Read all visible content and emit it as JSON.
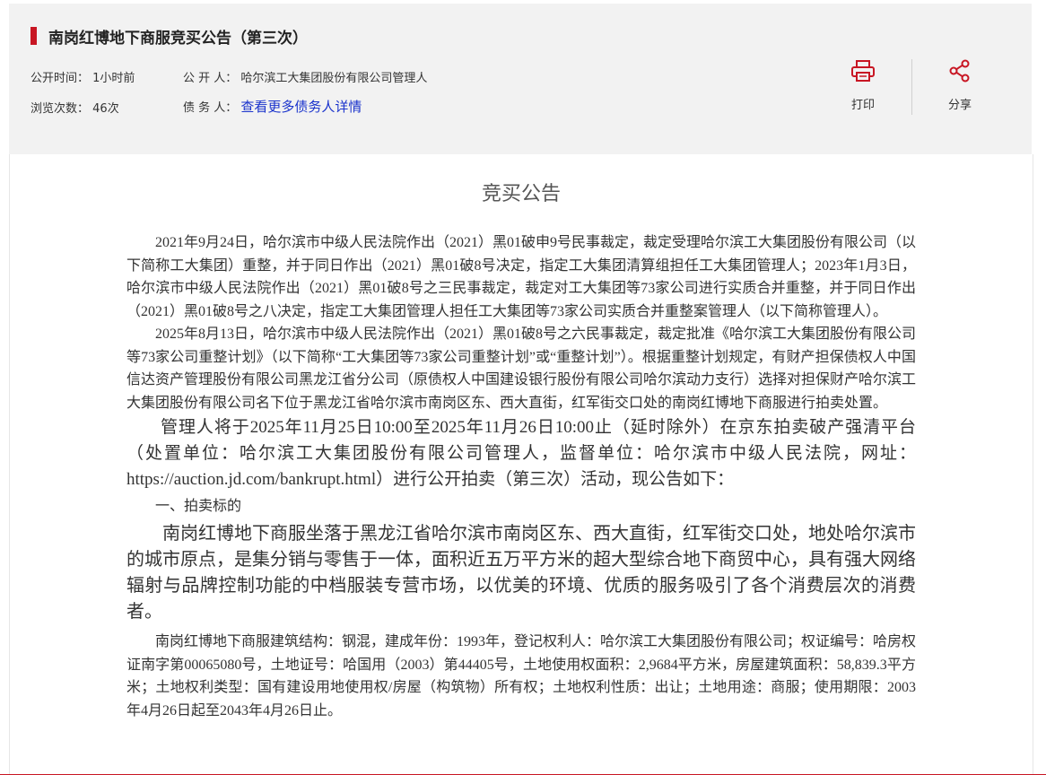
{
  "header": {
    "title": "南岗红博地下商服竞买公告（第三次）",
    "publish_time_label": "公开时间：",
    "publish_time_value": "1小时前",
    "publisher_label": "公 开 人：",
    "publisher_value": "哈尔滨工大集团股份有限公司管理人",
    "views_label": "浏览次数：",
    "views_value": "46次",
    "debtor_label": "债 务 人：",
    "debtor_link": "查看更多债务人详情",
    "print_label": "打印",
    "share_label": "分享",
    "accent_color": "#c81623"
  },
  "article": {
    "heading": "竞买公告",
    "paragraphs": [
      "2021年9月24日，哈尔滨市中级人民法院作出（2021）黑01破申9号民事裁定，裁定受理哈尔滨工大集团股份有限公司（以下简称工大集团）重整，并于同日作出（2021）黑01破8号决定，指定工大集团清算组担任工大集团管理人；2023年1月3日，哈尔滨市中级人民法院作出（2021）黑01破8号之三民事裁定，裁定对工大集团等73家公司进行实质合并重整，并于同日作出（2021）黑01破8号之八决定，指定工大集团管理人担任工大集团等73家公司实质合并重整案管理人（以下简称管理人）。",
      "2025年8月13日，哈尔滨市中级人民法院作出（2021）黑01破8号之六民事裁定，裁定批准《哈尔滨工大集团股份有限公司等73家公司重整计划》（以下简称“工大集团等73家公司重整计划”或“重整计划”）。根据重整计划规定，有财产担保债权人中国信达资产管理股份有限公司黑龙江省分公司（原债权人中国建设银行股份有限公司哈尔滨动力支行）选择对担保财产哈尔滨工大集团股份有限公司名下位于黑龙江省哈尔滨市南岗区东、西大直街，红军街交口处的南岗红博地下商服进行拍卖处置。",
      "管理人将于2025年11月25日10:00至2025年11月26日10:00止（延时除外）在京东拍卖破产强清平台（处置单位：哈尔滨工大集团股份有限公司管理人，监督单位：哈尔滨市中级人民法院，网址：https://auction.jd.com/bankrupt.html）进行公开拍卖（第三次）活动，现公告如下：",
      "一、拍卖标的",
      "南岗红博地下商服坐落于黑龙江省哈尔滨市南岗区东、西大直街，红军街交口处，地处哈尔滨市的城市原点，是集分销与零售于一体，面积近五万平方米的超大型综合地下商贸中心，具有强大网络辐射与品牌控制功能的中档服装专营市场，以优美的环境、优质的服务吸引了各个消费层次的消费者。",
      "南岗红博地下商服建筑结构：钢混，建成年份：1993年，登记权利人：哈尔滨工大集团股份有限公司；权证编号：哈房权证南字第00065080号，土地证号：哈国用（2003）第44405号，土地使用权面积：2,9684平方米，房屋建筑面积：58,839.3平方米；土地权利类型：国有建设用地使用权/房屋（构筑物）所有权；土地权利性质：出让；土地用途：商服；使用期限：2003年4月26日起至2043年4月26日止。"
    ]
  }
}
